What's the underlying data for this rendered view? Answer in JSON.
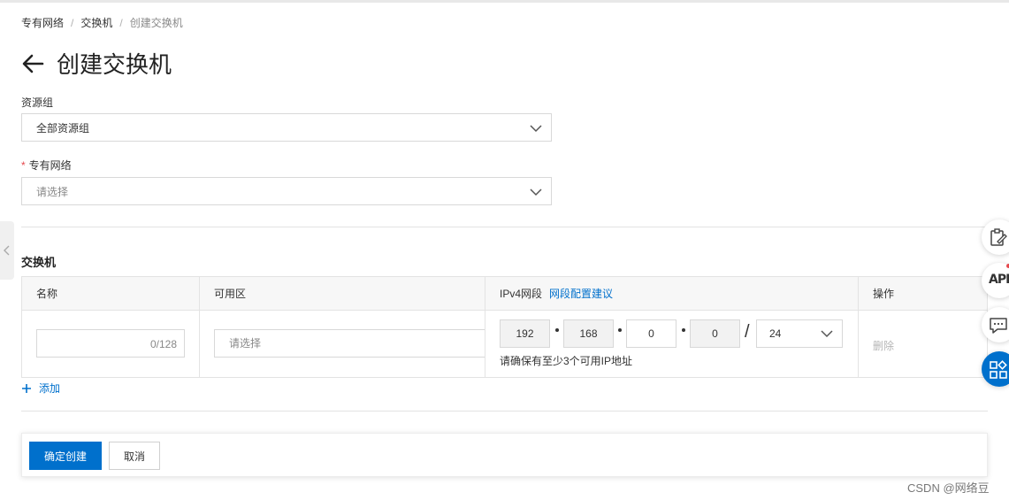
{
  "breadcrumb": {
    "items": [
      "专有网络",
      "交换机"
    ],
    "separator": "/",
    "current": "创建交换机"
  },
  "page_title": "创建交换机",
  "resource_group": {
    "label": "资源组",
    "value": "全部资源组"
  },
  "vpc": {
    "label": "专有网络",
    "required_mark": "*",
    "placeholder": "请选择"
  },
  "switch_section": {
    "title": "交换机",
    "columns": {
      "name": "名称",
      "zone": "可用区",
      "ipv4": "IPv4网段",
      "ipv4_link": "网段配置建议",
      "action": "操作"
    },
    "row": {
      "name_counter": "0/128",
      "zone_placeholder": "请选择",
      "ip_octets": [
        "192",
        "168",
        "0",
        "0"
      ],
      "ip_slash": "/",
      "mask": "24",
      "ip_hint": "请确保有至少3个可用IP地址",
      "delete_label": "删除"
    },
    "add_label": "添加"
  },
  "footer": {
    "confirm_label": "确定创建",
    "cancel_label": "取消"
  },
  "floating_tools": {
    "api_label": "API"
  },
  "watermark": "CSDN @网络豆",
  "colors": {
    "primary": "#0070cc",
    "required": "#e5484d",
    "border": "#d8d8d8"
  }
}
